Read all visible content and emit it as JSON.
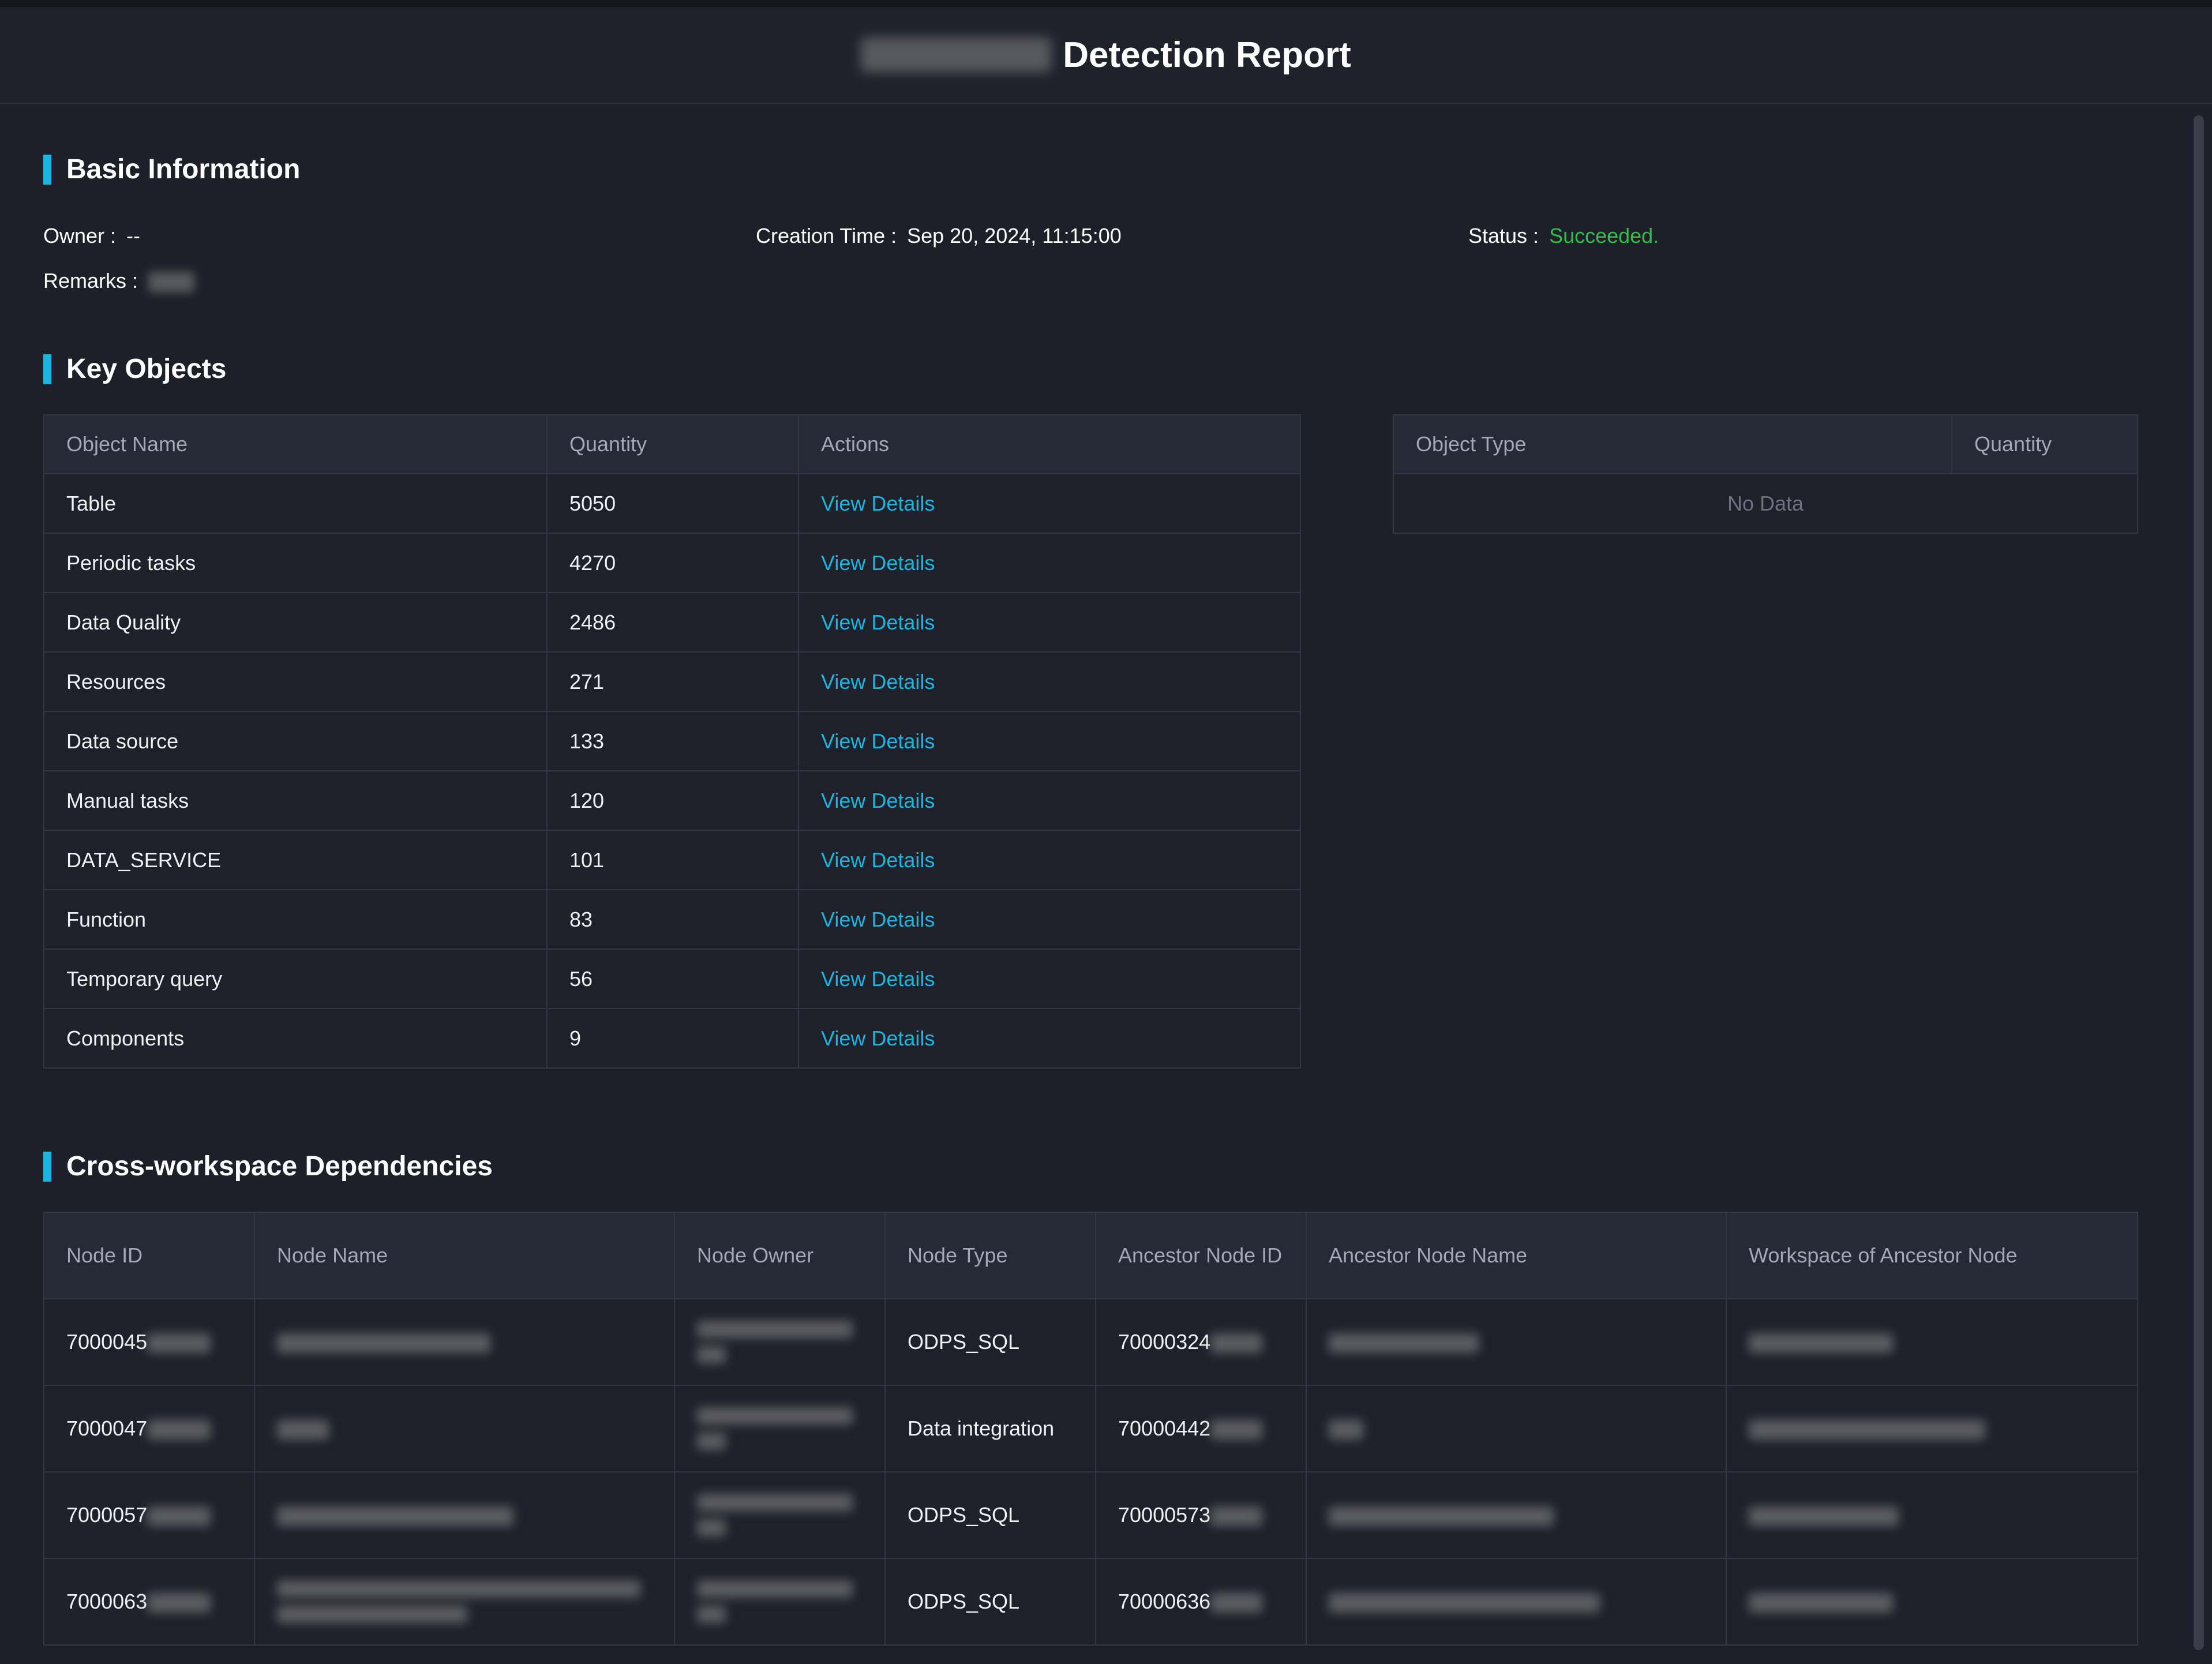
{
  "header": {
    "title": "Detection Report"
  },
  "basic": {
    "heading": "Basic Information",
    "owner_label": "Owner :",
    "owner_value": "--",
    "creation_label": "Creation Time :",
    "creation_value": "Sep 20, 2024, 11:15:00",
    "status_label": "Status :",
    "status_value": "Succeeded.",
    "remarks_label": "Remarks :"
  },
  "key_objects": {
    "heading": "Key Objects",
    "columns": [
      "Object Name",
      "Quantity",
      "Actions"
    ],
    "rows": [
      {
        "name": "Table",
        "qty": "5050",
        "action": "View Details"
      },
      {
        "name": "Periodic tasks",
        "qty": "4270",
        "action": "View Details"
      },
      {
        "name": "Data Quality",
        "qty": "2486",
        "action": "View Details"
      },
      {
        "name": "Resources",
        "qty": "271",
        "action": "View Details"
      },
      {
        "name": "Data source",
        "qty": "133",
        "action": "View Details"
      },
      {
        "name": "Manual tasks",
        "qty": "120",
        "action": "View Details"
      },
      {
        "name": "DATA_SERVICE",
        "qty": "101",
        "action": "View Details"
      },
      {
        "name": "Function",
        "qty": "83",
        "action": "View Details"
      },
      {
        "name": "Temporary query",
        "qty": "56",
        "action": "View Details"
      },
      {
        "name": "Components",
        "qty": "9",
        "action": "View Details"
      }
    ],
    "side_columns": [
      "Object Type",
      "Quantity"
    ],
    "side_empty": "No Data"
  },
  "deps": {
    "heading": "Cross-workspace Dependencies",
    "columns": [
      "Node ID",
      "Node Name",
      "Node Owner",
      "Node Type",
      "Ancestor Node ID",
      "Ancestor Node Name",
      "Workspace of Ancestor Node"
    ],
    "rows": [
      {
        "node_id": "7000045",
        "node_type": "ODPS_SQL",
        "ancestor_id": "70000324"
      },
      {
        "node_id": "7000047",
        "node_type": "Data integration",
        "ancestor_id": "70000442"
      },
      {
        "node_id": "7000057",
        "node_type": "ODPS_SQL",
        "ancestor_id": "70000573"
      },
      {
        "node_id": "7000063",
        "node_type": "ODPS_SQL",
        "ancestor_id": "70000636"
      }
    ]
  }
}
